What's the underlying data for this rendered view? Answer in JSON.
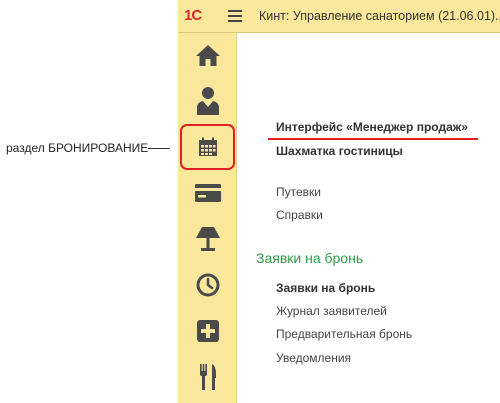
{
  "titlebar": {
    "logo": "1С",
    "title": "Кинт: Управление санаторием (21.06.01)..."
  },
  "sidebar": {
    "items": [
      {
        "icon": "home-icon"
      },
      {
        "icon": "person-icon"
      },
      {
        "icon": "calendar-icon",
        "selected": true
      },
      {
        "icon": "credit-card-icon"
      },
      {
        "icon": "lamp-icon"
      },
      {
        "icon": "clock-icon"
      },
      {
        "icon": "medical-cross-icon"
      },
      {
        "icon": "fork-knife-icon"
      }
    ]
  },
  "annotation": {
    "label": "раздел БРОНИРОВАНИЕ"
  },
  "main": {
    "links_top": [
      {
        "label": "Интерфейс «Менеджер продаж»"
      },
      {
        "label": "Шахматка гостиницы"
      }
    ],
    "links_mid": [
      {
        "label": "Путевки"
      },
      {
        "label": "Справки"
      }
    ],
    "section": {
      "title": "Заявки на бронь",
      "links": [
        {
          "label": "Заявки на бронь"
        },
        {
          "label": "Журнал заявителей"
        },
        {
          "label": "Предварительная бронь"
        },
        {
          "label": "Уведомления"
        }
      ]
    }
  },
  "colors": {
    "panel": "#f9e89c",
    "icon": "#4a4a4a",
    "accent_red": "#e02020",
    "section_green": "#2e9a4a"
  }
}
